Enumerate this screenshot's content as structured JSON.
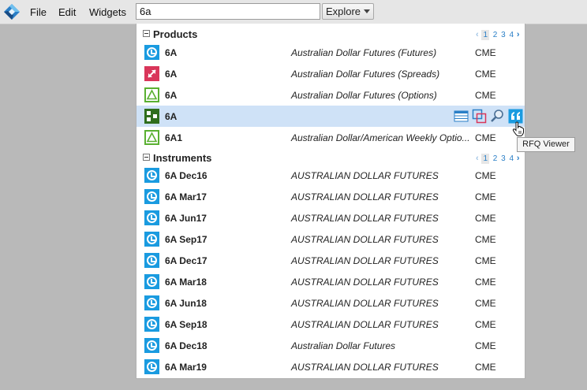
{
  "menubar": {
    "menus": [
      "File",
      "Edit",
      "Widgets"
    ],
    "search_value": "6a",
    "explore_label": "Explore"
  },
  "products": {
    "title": "Products",
    "pager": {
      "prev": "‹",
      "pages": [
        "1",
        "2",
        "3",
        "4"
      ],
      "current": "1",
      "next": "›"
    },
    "rows": [
      {
        "symbol": "6A",
        "description": "Australian Dollar Futures (Futures)",
        "exchange": "CME",
        "icon": "futures-clock-icon"
      },
      {
        "symbol": "6A",
        "description": "Australian Dollar Futures (Spreads)",
        "exchange": "CME",
        "icon": "spread-arrows-icon"
      },
      {
        "symbol": "6A",
        "description": "Australian Dollar Futures (Options)",
        "exchange": "CME",
        "icon": "options-triangle-icon"
      },
      {
        "symbol": "6A",
        "description": "",
        "exchange": "",
        "icon": "strategy-blocks-icon"
      },
      {
        "symbol": "6A1",
        "description": "Australian Dollar/American Weekly Optio...",
        "exchange": "CME",
        "icon": "options-triangle-icon"
      }
    ]
  },
  "instruments": {
    "title": "Instruments",
    "pager": {
      "prev": "‹",
      "pages": [
        "1",
        "2",
        "3",
        "4"
      ],
      "current": "1",
      "next": "›"
    },
    "rows": [
      {
        "symbol": "6A Dec16",
        "description": "AUSTRALIAN DOLLAR FUTURES",
        "exchange": "CME"
      },
      {
        "symbol": "6A Mar17",
        "description": "AUSTRALIAN DOLLAR FUTURES",
        "exchange": "CME"
      },
      {
        "symbol": "6A Jun17",
        "description": "AUSTRALIAN DOLLAR FUTURES",
        "exchange": "CME"
      },
      {
        "symbol": "6A Sep17",
        "description": "AUSTRALIAN DOLLAR FUTURES",
        "exchange": "CME"
      },
      {
        "symbol": "6A Dec17",
        "description": "AUSTRALIAN DOLLAR FUTURES",
        "exchange": "CME"
      },
      {
        "symbol": "6A Mar18",
        "description": "AUSTRALIAN DOLLAR FUTURES",
        "exchange": "CME"
      },
      {
        "symbol": "6A Jun18",
        "description": "AUSTRALIAN DOLLAR FUTURES",
        "exchange": "CME"
      },
      {
        "symbol": "6A Sep18",
        "description": "AUSTRALIAN DOLLAR FUTURES",
        "exchange": "CME"
      },
      {
        "symbol": "6A Dec18",
        "description": "Australian Dollar Futures",
        "exchange": "CME"
      },
      {
        "symbol": "6A Mar19",
        "description": "AUSTRALIAN DOLLAR FUTURES",
        "exchange": "CME"
      }
    ]
  },
  "tooltip": {
    "text": "RFQ Viewer"
  },
  "colors": {
    "accent_blue": "#1a9be0",
    "spread_red": "#d9365a",
    "options_green": "#5ab031",
    "strategy_dark_green": "#2f6e1d",
    "selected_row": "#cfe2f7"
  }
}
